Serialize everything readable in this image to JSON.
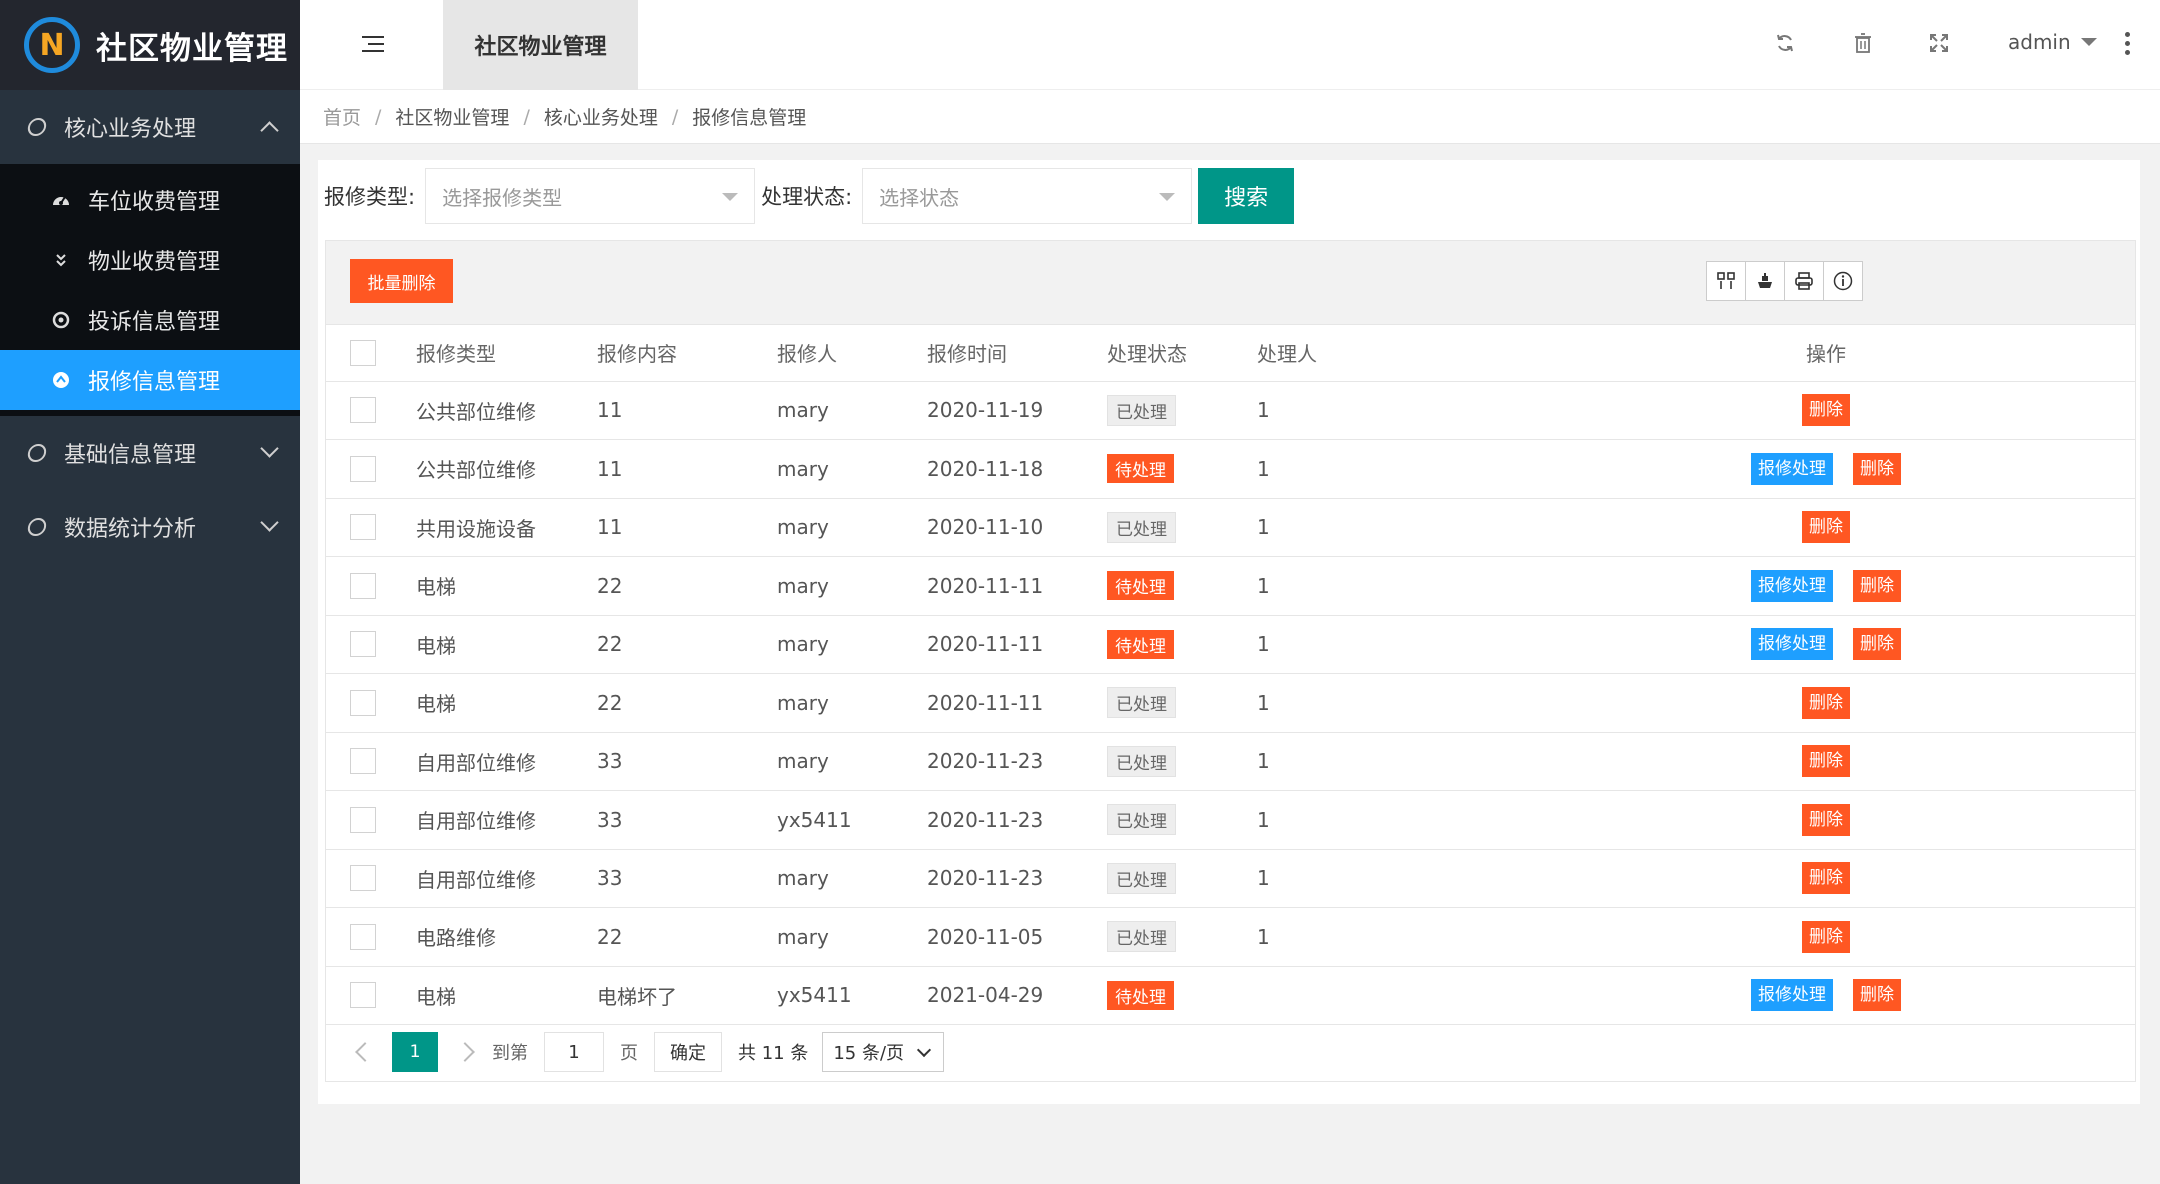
{
  "sidebar": {
    "logo_letter": "N",
    "logo_text": "社区物业管理",
    "groups": [
      {
        "label": "核心业务处理",
        "expanded": true
      },
      {
        "label": "基础信息管理",
        "expanded": false
      },
      {
        "label": "数据统计分析",
        "expanded": false
      }
    ],
    "sub_items": [
      {
        "label": "车位收费管理",
        "icon": "dashboard-icon"
      },
      {
        "label": "物业收费管理",
        "icon": "double-chevron-down-icon"
      },
      {
        "label": "投诉信息管理",
        "icon": "target-icon"
      },
      {
        "label": "报修信息管理",
        "icon": "upload-circle-icon",
        "active": true
      }
    ]
  },
  "header": {
    "active_tab": "社区物业管理",
    "user": "admin"
  },
  "breadcrumb": [
    "首页",
    "社区物业管理",
    "核心业务处理",
    "报修信息管理"
  ],
  "filters": {
    "type_label": "报修类型:",
    "type_placeholder": "选择报修类型",
    "status_label": "处理状态:",
    "status_placeholder": "选择状态",
    "search_label": "搜索"
  },
  "toolbar": {
    "batch_delete": "批量删除"
  },
  "table": {
    "columns": [
      "报修类型",
      "报修内容",
      "报修人",
      "报修时间",
      "处理状态",
      "处理人",
      "操作"
    ],
    "rows": [
      {
        "type": "公共部位维修",
        "content": "11",
        "person": "mary",
        "time": "2020-11-19",
        "status": "已处理",
        "pending": false,
        "handler": "1"
      },
      {
        "type": "公共部位维修",
        "content": "11",
        "person": "mary",
        "time": "2020-11-18",
        "status": "待处理",
        "pending": true,
        "handler": "1"
      },
      {
        "type": "共用设施设备",
        "content": "11",
        "person": "mary",
        "time": "2020-11-10",
        "status": "已处理",
        "pending": false,
        "handler": "1"
      },
      {
        "type": "电梯",
        "content": "22",
        "person": "mary",
        "time": "2020-11-11",
        "status": "待处理",
        "pending": true,
        "handler": "1"
      },
      {
        "type": "电梯",
        "content": "22",
        "person": "mary",
        "time": "2020-11-11",
        "status": "待处理",
        "pending": true,
        "handler": "1"
      },
      {
        "type": "电梯",
        "content": "22",
        "person": "mary",
        "time": "2020-11-11",
        "status": "已处理",
        "pending": false,
        "handler": "1"
      },
      {
        "type": "自用部位维修",
        "content": "33",
        "person": "mary",
        "time": "2020-11-23",
        "status": "已处理",
        "pending": false,
        "handler": "1"
      },
      {
        "type": "自用部位维修",
        "content": "33",
        "person": "yx5411",
        "time": "2020-11-23",
        "status": "已处理",
        "pending": false,
        "handler": "1"
      },
      {
        "type": "自用部位维修",
        "content": "33",
        "person": "mary",
        "time": "2020-11-23",
        "status": "已处理",
        "pending": false,
        "handler": "1"
      },
      {
        "type": "电路维修",
        "content": "22",
        "person": "mary",
        "time": "2020-11-05",
        "status": "已处理",
        "pending": false,
        "handler": "1"
      },
      {
        "type": "电梯",
        "content": "电梯坏了",
        "person": "yx5411",
        "time": "2021-04-29",
        "status": "待处理",
        "pending": true,
        "handler": ""
      }
    ],
    "handle_label": "报修处理",
    "delete_label": "删除"
  },
  "pager": {
    "current": "1",
    "goto_label": "到第",
    "goto_value": "1",
    "page_label": "页",
    "confirm_label": "确定",
    "total": "共 11 条",
    "size": "15 条/页"
  },
  "colors": {
    "accent": "#009688",
    "blue": "#1e9fff",
    "danger": "#ff5722",
    "sidebar": "#28333e"
  }
}
